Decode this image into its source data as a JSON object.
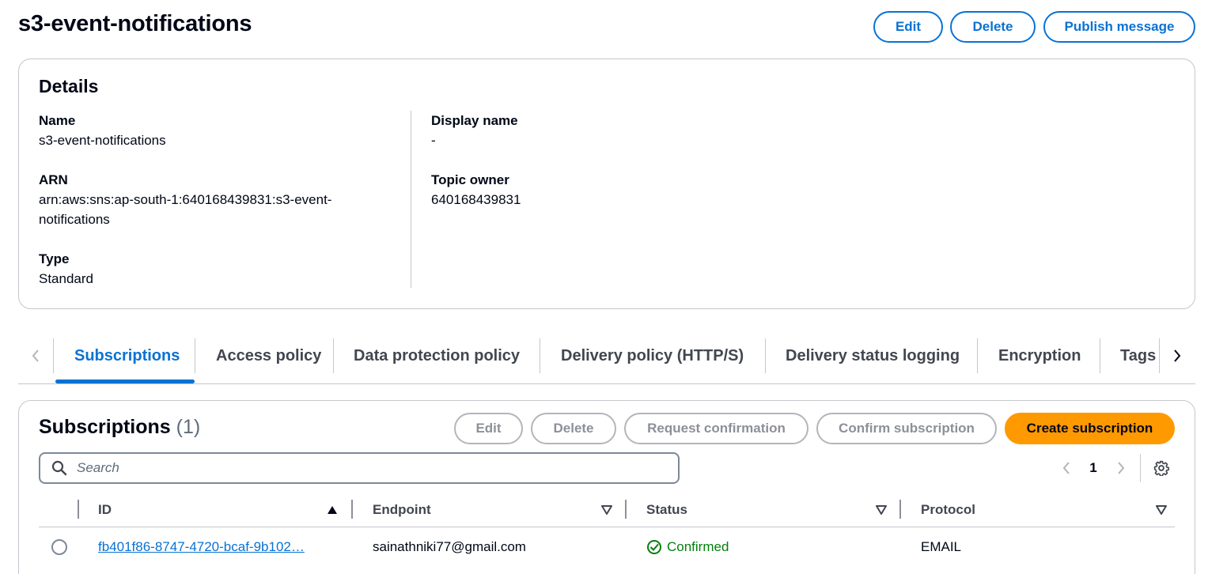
{
  "page": {
    "title": "s3-event-notifications",
    "actions": {
      "edit": "Edit",
      "delete": "Delete",
      "publish": "Publish message"
    }
  },
  "details": {
    "heading": "Details",
    "name_label": "Name",
    "name_value": "s3-event-notifications",
    "arn_label": "ARN",
    "arn_value_line1": "arn:aws:sns:ap-south-1:640168439831:s3-event-",
    "arn_value_line2": "notifications",
    "type_label": "Type",
    "type_value": "Standard",
    "display_name_label": "Display name",
    "display_name_value": "-",
    "topic_owner_label": "Topic owner",
    "topic_owner_value": "640168439831"
  },
  "tabs": [
    {
      "label": "Subscriptions",
      "active": true
    },
    {
      "label": "Access policy"
    },
    {
      "label": "Data protection policy"
    },
    {
      "label": "Delivery policy (HTTP/S)"
    },
    {
      "label": "Delivery status logging"
    },
    {
      "label": "Encryption"
    },
    {
      "label": "Tags"
    }
  ],
  "subscriptions": {
    "title": "Subscriptions",
    "count": "(1)",
    "actions": {
      "edit": "Edit",
      "delete": "Delete",
      "request_confirmation": "Request confirmation",
      "confirm_subscription": "Confirm subscription",
      "create": "Create subscription"
    },
    "search_placeholder": "Search",
    "pagination": {
      "current_page": "1"
    },
    "columns": {
      "id": "ID",
      "endpoint": "Endpoint",
      "status": "Status",
      "protocol": "Protocol"
    },
    "rows": [
      {
        "id": "fb401f86-8747-4720-bcaf-9b102…",
        "endpoint": "sainathniki77@gmail.com",
        "status": "Confirmed",
        "protocol": "EMAIL"
      }
    ]
  },
  "colors": {
    "accent": "#0972d3",
    "primary_button": "#ff9900",
    "success": "#037f0c",
    "border": "#c6c6cd"
  },
  "icons": {
    "search": "search-icon",
    "settings": "gear-icon",
    "sort_asc": "sort-ascending-icon",
    "sort_desc": "sort-descending-icon",
    "status_ok": "check-circle-icon",
    "prev": "chevron-left-icon",
    "next": "chevron-right-icon"
  }
}
